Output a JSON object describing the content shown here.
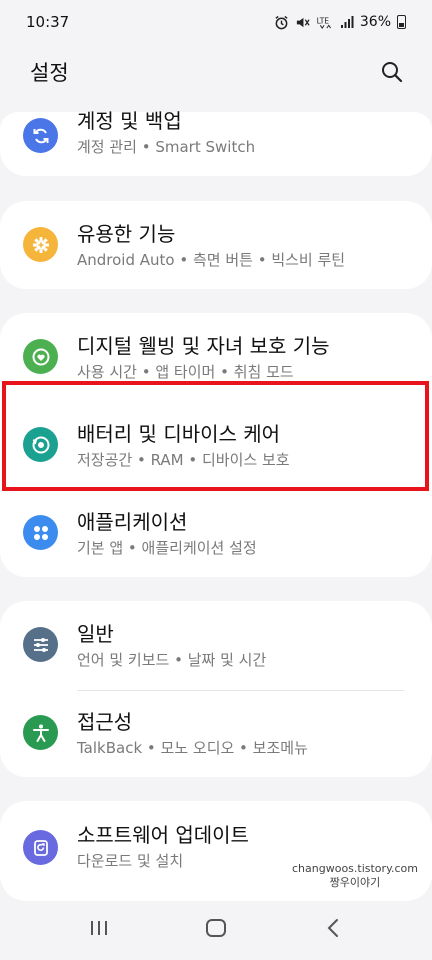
{
  "status_bar": {
    "time": "10:37",
    "battery": "36%",
    "icons": [
      "alarm-icon",
      "mute-icon",
      "lte-icon",
      "signal-icon",
      "battery-icon"
    ]
  },
  "header": {
    "title": "설정",
    "search_icon": "search-icon"
  },
  "items": [
    {
      "title": "계정 및 백업",
      "subtitle": "계정 관리 • Smart Switch",
      "icon": "sync-icon",
      "color": "#4a76e8"
    },
    {
      "title": "유용한 기능",
      "subtitle": "Android Auto • 측면 버튼 • 빅스비 루틴",
      "icon": "gear-plus-icon",
      "color": "#f5b53a"
    },
    {
      "title": "디지털 웰빙 및 자녀 보호 기능",
      "subtitle": "사용 시간 • 앱 타이머 • 취침 모드",
      "icon": "heart-circle-icon",
      "color": "#4caf50"
    },
    {
      "title": "배터리 및 디바이스 케어",
      "subtitle": "저장공간 • RAM • 디바이스 보호",
      "icon": "device-care-icon",
      "color": "#1aa190"
    },
    {
      "title": "애플리케이션",
      "subtitle": "기본 앱 • 애플리케이션 설정",
      "icon": "apps-grid-icon",
      "color": "#3c8cf0"
    },
    {
      "title": "일반",
      "subtitle": "언어 및 키보드 • 날짜 및 시간",
      "icon": "sliders-icon",
      "color": "#56708a"
    },
    {
      "title": "접근성",
      "subtitle": "TalkBack • 모노 오디오 • 보조메뉴",
      "icon": "accessibility-icon",
      "color": "#2a9a52"
    },
    {
      "title": "소프트웨어 업데이트",
      "subtitle": "다운로드 및 설치",
      "icon": "update-icon",
      "color": "#6a6ae0"
    }
  ],
  "watermark": {
    "line1": "changwoos.tistory.com",
    "line2": "짱우이야기"
  },
  "navbar": {
    "icons": [
      "recent-apps-icon",
      "home-icon",
      "back-icon"
    ]
  },
  "highlight_color": "#e8141c"
}
